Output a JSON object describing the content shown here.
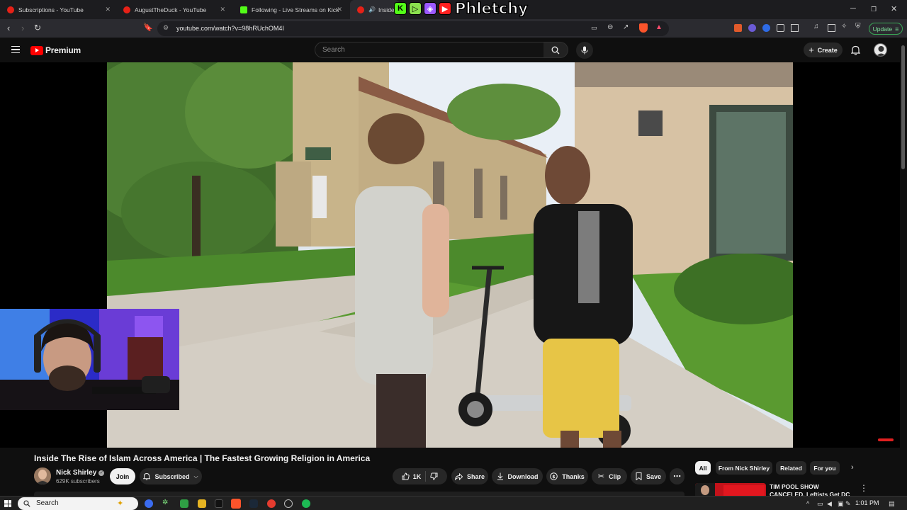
{
  "browser": {
    "tabs": [
      {
        "title": "Subscriptions - YouTube",
        "color": "#e62117"
      },
      {
        "title": "AugustTheDuck - YouTube",
        "color": "#e62117"
      },
      {
        "title": "Following - Live Streams on Kick",
        "color": "#53fc18"
      },
      {
        "title": "Inside T",
        "color": "#e62117"
      }
    ],
    "url": "youtube.com/watch?v=98hRUchOM4I",
    "update_label": "Update"
  },
  "overlay": {
    "chips": [
      "K",
      "▷",
      "◈",
      "▶"
    ],
    "text": "Phletchy"
  },
  "youtube": {
    "logo_text": "Premium",
    "search_placeholder": "Search",
    "create_label": "Create"
  },
  "video": {
    "title": "Inside The Rise of Islam Across America | The Fastest Growing Religion in America",
    "channel": "Nick Shirley",
    "subscribers": "629K subscribers",
    "join_label": "Join",
    "subscribed_label": "Subscribed",
    "likes": "1K",
    "share_label": "Share",
    "download_label": "Download",
    "thanks_label": "Thanks",
    "clip_label": "Clip",
    "save_label": "Save"
  },
  "sidebar": {
    "chips": [
      "All",
      "From Nick Shirley",
      "Related",
      "For you"
    ],
    "recommendation": {
      "title": "TIM POOL SHOW CANCELED, Leftists Get DC Comedy Loft T"
    }
  },
  "taskbar": {
    "search_label": "Search",
    "time": "1:01 PM"
  }
}
